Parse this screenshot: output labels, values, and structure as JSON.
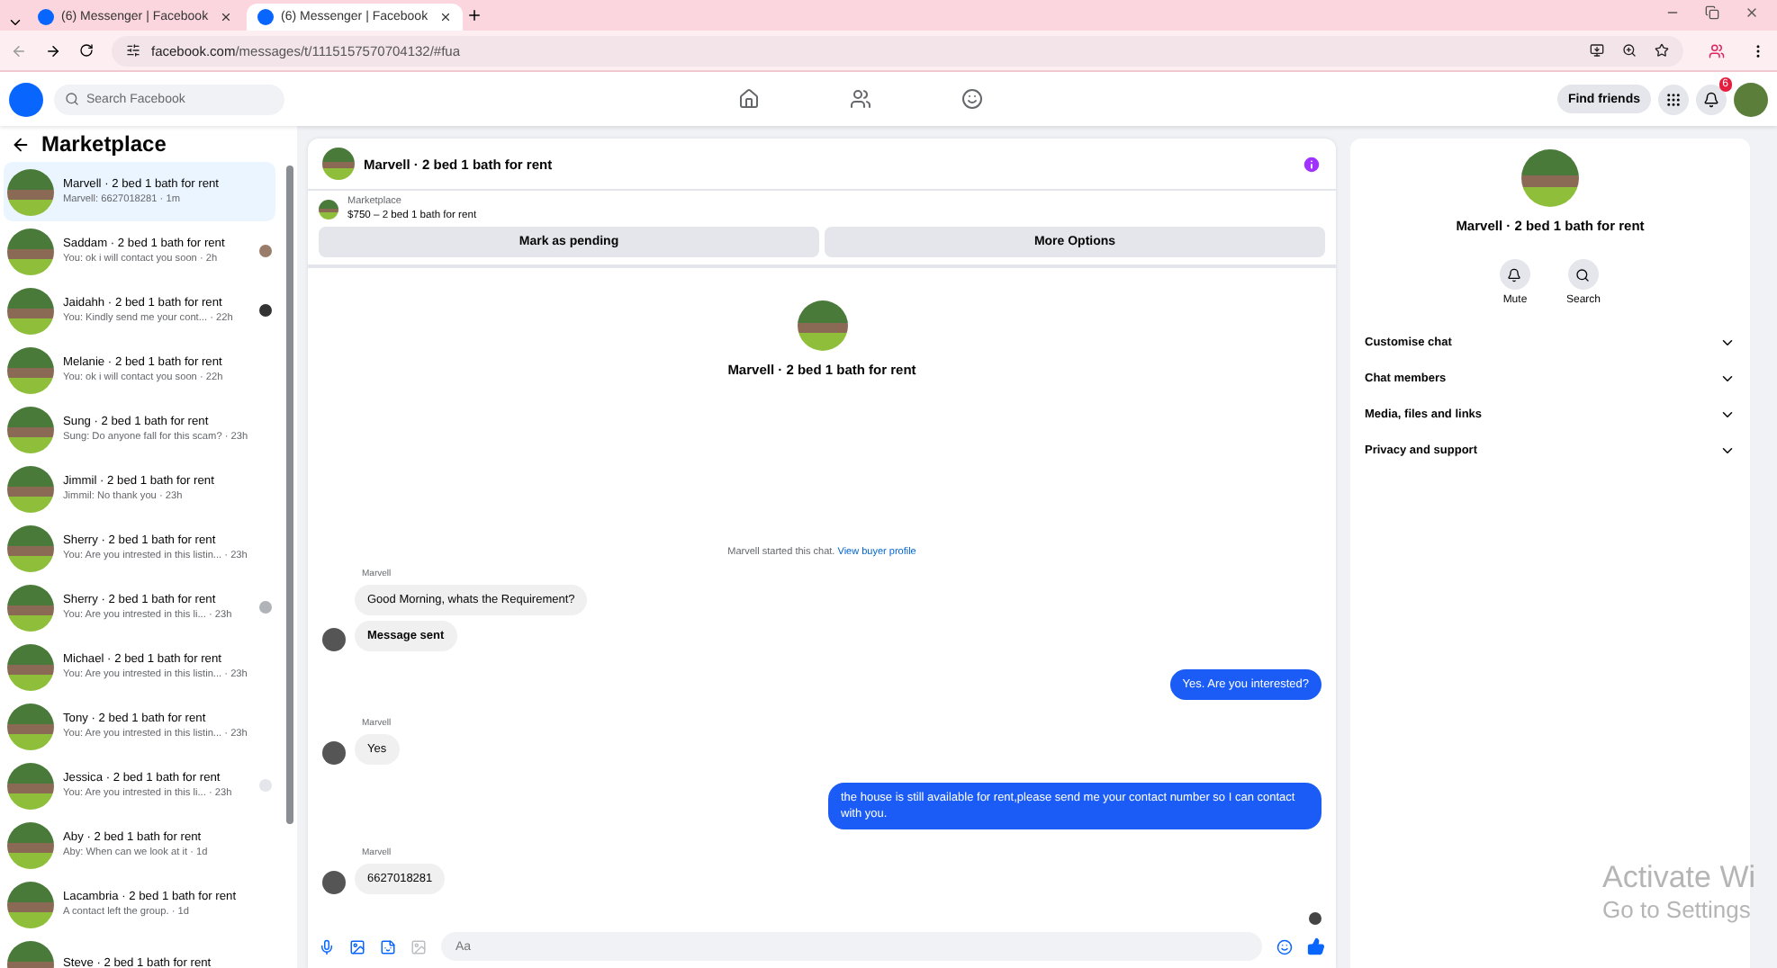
{
  "browser": {
    "tabs": [
      {
        "title": "(6) Messenger | Facebook",
        "selected": false
      },
      {
        "title": "(6) Messenger | Facebook",
        "selected": true
      }
    ],
    "url_host": "facebook.com",
    "url_path": "/messages/t/1115157570704132/#fua"
  },
  "topbar": {
    "search_placeholder": "Search Facebook",
    "find_friends": "Find friends",
    "notification_count": "6"
  },
  "sidebar": {
    "title": "Marketplace",
    "conversations": [
      {
        "title": "Marvell · 2 bed 1 bath for rent",
        "preview": "Marvell: 6627018281 · 1m",
        "selected": true
      },
      {
        "title": "Saddam · 2 bed 1 bath for rent",
        "preview": "You: ok i will contact you soon · 2h",
        "selected": false,
        "receipt": {
          "color": "#9a7c6a"
        }
      },
      {
        "title": "Jaidahh · 2 bed 1 bath for rent",
        "preview": "You: Kindly send me your cont... · 22h",
        "selected": false,
        "receipt": {
          "color": "#333333"
        }
      },
      {
        "title": "Melanie · 2 bed 1 bath for rent",
        "preview": "You: ok i will contact you soon · 22h",
        "selected": false
      },
      {
        "title": "Sung · 2 bed 1 bath for rent",
        "preview": "Sung: Do anyone fall for this scam? · 23h",
        "selected": false
      },
      {
        "title": "Jimmil · 2 bed 1 bath for rent",
        "preview": "Jimmil: No thank you · 23h",
        "selected": false
      },
      {
        "title": "Sherry · 2 bed 1 bath for rent",
        "preview": "You: Are you intrested in this listin... · 23h",
        "selected": false
      },
      {
        "title": "Sherry · 2 bed 1 bath for rent",
        "preview": "You: Are you intrested in this li... · 23h",
        "selected": false,
        "receipt": {
          "color": "#b0b3b8"
        }
      },
      {
        "title": "Michael · 2 bed 1 bath for rent",
        "preview": "You: Are you intrested in this listin... · 23h",
        "selected": false
      },
      {
        "title": "Tony · 2 bed 1 bath for rent",
        "preview": "You: Are you intrested in this listin... · 23h",
        "selected": false
      },
      {
        "title": "Jessica · 2 bed 1 bath for rent",
        "preview": "You: Are you intrested in this li... · 23h",
        "selected": false,
        "receipt": {
          "color": "#e4e6eb"
        }
      },
      {
        "title": "Aby · 2 bed 1 bath for rent",
        "preview": "Aby: When can we look at it · 1d",
        "selected": false
      },
      {
        "title": "Lacambria · 2 bed 1 bath for rent",
        "preview": "A contact left the group. · 1d",
        "selected": false
      },
      {
        "title": "Steve · 2 bed 1 bath for rent",
        "selected": false
      }
    ]
  },
  "chat": {
    "title": "Marvell · 2 bed 1 bath for rent",
    "listing": {
      "label": "Marketplace",
      "price_title": "$750 – 2 bed 1 bath for rent",
      "buttons": [
        "Mark as pending",
        "More Options"
      ]
    },
    "intro_title": "Marvell · 2 bed 1 bath for rent",
    "started_text": "Marvell started this chat.",
    "started_link": "View buyer profile",
    "messages": [
      {
        "kind": "incoming",
        "sender": "Marvell",
        "texts": [
          "Good Morning, whats the Requirement?",
          "Message sent"
        ]
      },
      {
        "kind": "outgoing",
        "texts": [
          "Yes. Are you interested?"
        ]
      },
      {
        "kind": "incoming",
        "sender": "Marvell",
        "texts": [
          "Yes"
        ]
      },
      {
        "kind": "outgoing",
        "texts": [
          "the house is still available for rent,please send me your contact number so I can contact with you."
        ]
      },
      {
        "kind": "incoming",
        "sender": "Marvell",
        "texts": [
          "6627018281"
        ]
      }
    ],
    "composer_placeholder": "Aa"
  },
  "details": {
    "title": "Marvell · 2 bed 1 bath for rent",
    "actions": [
      "Mute",
      "Search"
    ],
    "sections": [
      "Customise chat",
      "Chat members",
      "Media, files and links",
      "Privacy and support"
    ]
  },
  "os_overlay": {
    "title": "Activate Wi",
    "subtitle": "Go to Settings"
  }
}
